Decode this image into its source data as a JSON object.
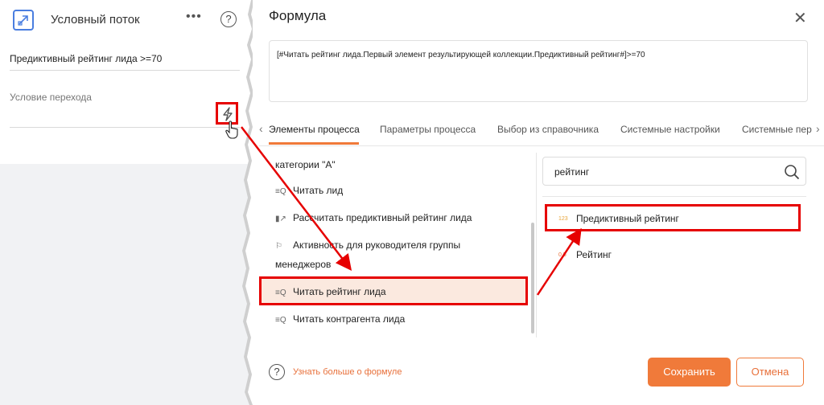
{
  "left_panel": {
    "title": "Условный поток",
    "more_icon": "ellipsis-icon",
    "help_label": "?",
    "condition_value": "Предиктивный рейтинг лида >=70",
    "transition_label": "Условие перехода",
    "formula_button_icon": "lightning-icon"
  },
  "dialog": {
    "title": "Формула",
    "close_label": "✕",
    "formula_text": "[#Читать рейтинг лида.Первый элемент результирующей коллекции.Предиктивный рейтинг#]>=70",
    "tabs": [
      {
        "label": "Элементы процесса",
        "active": true
      },
      {
        "label": "Параметры процесса",
        "active": false
      },
      {
        "label": "Выбор из справочника",
        "active": false
      },
      {
        "label": "Системные настройки",
        "active": false
      },
      {
        "label": "Системные пер",
        "active": false
      }
    ],
    "tab_prev": "‹",
    "tab_next": "›",
    "elements": [
      {
        "label": "категории \"А\"",
        "icon": ""
      },
      {
        "label": "Читать лид",
        "icon": "read-data-icon"
      },
      {
        "label": "Рассчитать предиктивный рейтинг лида",
        "icon": "chart-icon"
      },
      {
        "label": "Активность для руководителя группы",
        "icon": "flag-icon"
      },
      {
        "label": "менеджеров",
        "icon": ""
      },
      {
        "label": "Читать рейтинг лида",
        "icon": "read-data-icon",
        "selected": true
      },
      {
        "label": "Читать контрагента лида",
        "icon": "read-data-icon"
      }
    ],
    "search_value": "рейтинг",
    "results": [
      {
        "badge": "123",
        "label": "Предиктивный рейтинг",
        "highlighted": true
      },
      {
        "badge": "0.5",
        "label": "Рейтинг",
        "highlighted": false
      }
    ],
    "learn_more": "Узнать больше о формуле",
    "save_label": "Сохранить",
    "cancel_label": "Отмена"
  },
  "colors": {
    "accent": "#f07a3a",
    "highlight_frame": "#e60000",
    "selected_bg": "#fbe9df",
    "icon_blue": "#4a7ee0"
  }
}
